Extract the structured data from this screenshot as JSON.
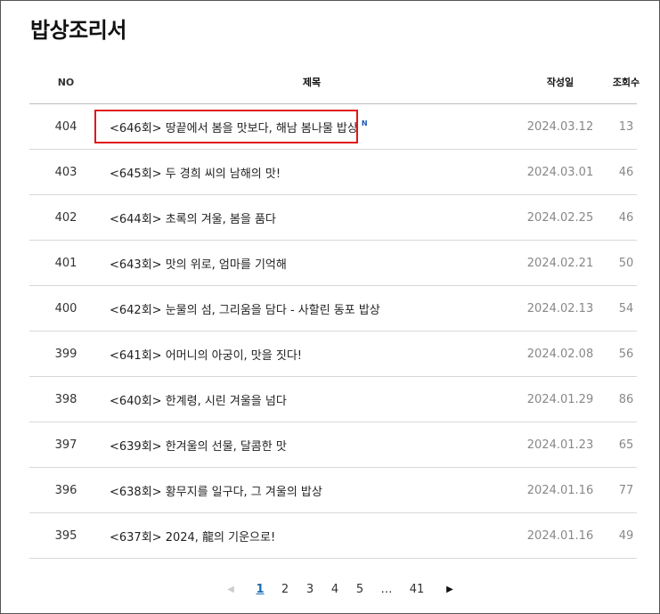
{
  "page": {
    "title": "밥상조리서"
  },
  "table": {
    "headers": {
      "no": "NO",
      "title": "제목",
      "date": "작성일",
      "views": "조회수"
    },
    "rows": [
      {
        "no": "404",
        "title": "<646회> 땅끝에서 봄을 맛보다, 해남 봄나물 밥상",
        "badge": "N",
        "date": "2024.03.12",
        "views": "13"
      },
      {
        "no": "403",
        "title": "<645회> 두 경희 씨의 남해의 맛!",
        "date": "2024.03.01",
        "views": "46"
      },
      {
        "no": "402",
        "title": "<644회> 초록의 겨울, 봄을 품다",
        "date": "2024.02.25",
        "views": "46"
      },
      {
        "no": "401",
        "title": "<643회> 맛의 위로, 엄마를 기억해",
        "date": "2024.02.21",
        "views": "50"
      },
      {
        "no": "400",
        "title": "<642회> 눈물의 섬, 그리움을 담다 - 사할린 동포 밥상",
        "date": "2024.02.13",
        "views": "54"
      },
      {
        "no": "399",
        "title": "<641회> 어머니의 아궁이, 맛을 짓다!",
        "date": "2024.02.08",
        "views": "56"
      },
      {
        "no": "398",
        "title": "<640회> 한계령, 시린 겨울을 넘다",
        "date": "2024.01.29",
        "views": "86"
      },
      {
        "no": "397",
        "title": "<639회> 한겨울의 선물, 달콤한 맛",
        "date": "2024.01.23",
        "views": "65"
      },
      {
        "no": "396",
        "title": "<638회> 황무지를 일구다, 그 겨울의 밥상",
        "date": "2024.01.16",
        "views": "77"
      },
      {
        "no": "395",
        "title": "<637회> 2024, 龍의 기운으로!",
        "date": "2024.01.16",
        "views": "49"
      }
    ]
  },
  "pagination": {
    "prev": "◀",
    "pages": [
      "1",
      "2",
      "3",
      "4",
      "5"
    ],
    "ellipsis": "…",
    "last": "41",
    "next": "▶",
    "current": "1"
  },
  "colors": {
    "highlight": "#e0161b",
    "new_badge": "#1a56b8",
    "current_page": "#1b6cb5"
  }
}
